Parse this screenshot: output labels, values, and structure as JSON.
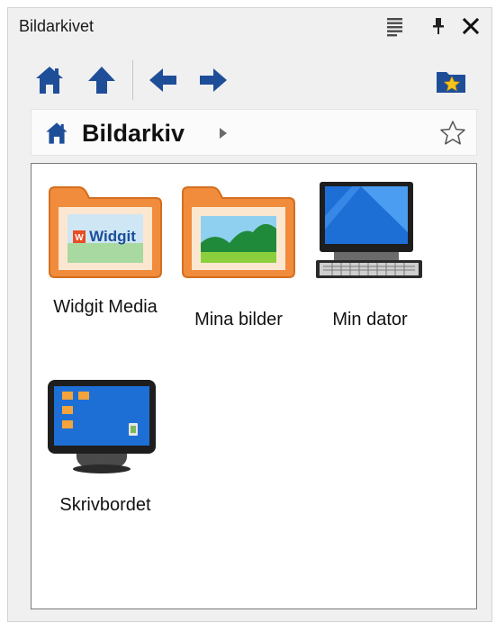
{
  "panel": {
    "title": "Bildarkivet",
    "title_buttons": [
      {
        "icon": "list-menu-icon"
      },
      {
        "icon": "pin-icon"
      },
      {
        "icon": "close-icon"
      }
    ]
  },
  "toolbar": {
    "buttons": [
      {
        "icon": "home-icon"
      },
      {
        "icon": "up-arrow-icon"
      },
      {
        "icon": "back-arrow-icon"
      },
      {
        "icon": "forward-arrow-icon"
      },
      {
        "icon": "favorite-folder-icon"
      }
    ]
  },
  "breadcrumb": {
    "icon": "home-icon",
    "location": "Bildarkiv",
    "expand_icon": "chevron-right-icon",
    "favorite_icon": "star-outline-icon"
  },
  "items": [
    {
      "label": "Widgit Media",
      "icon": "widgit-folder-icon",
      "badge": "Widgit"
    },
    {
      "label": "Mina bilder",
      "icon": "picture-folder-icon"
    },
    {
      "label": "Min dator",
      "icon": "computer-icon"
    },
    {
      "label": "Skrivbordet",
      "icon": "desktop-icon"
    }
  ],
  "colors": {
    "icon_blue": "#1f4e99",
    "folder_orange": "#f08c3c",
    "folder_inner": "#fbe7d0",
    "screen_blue": "#1d6fd6"
  }
}
